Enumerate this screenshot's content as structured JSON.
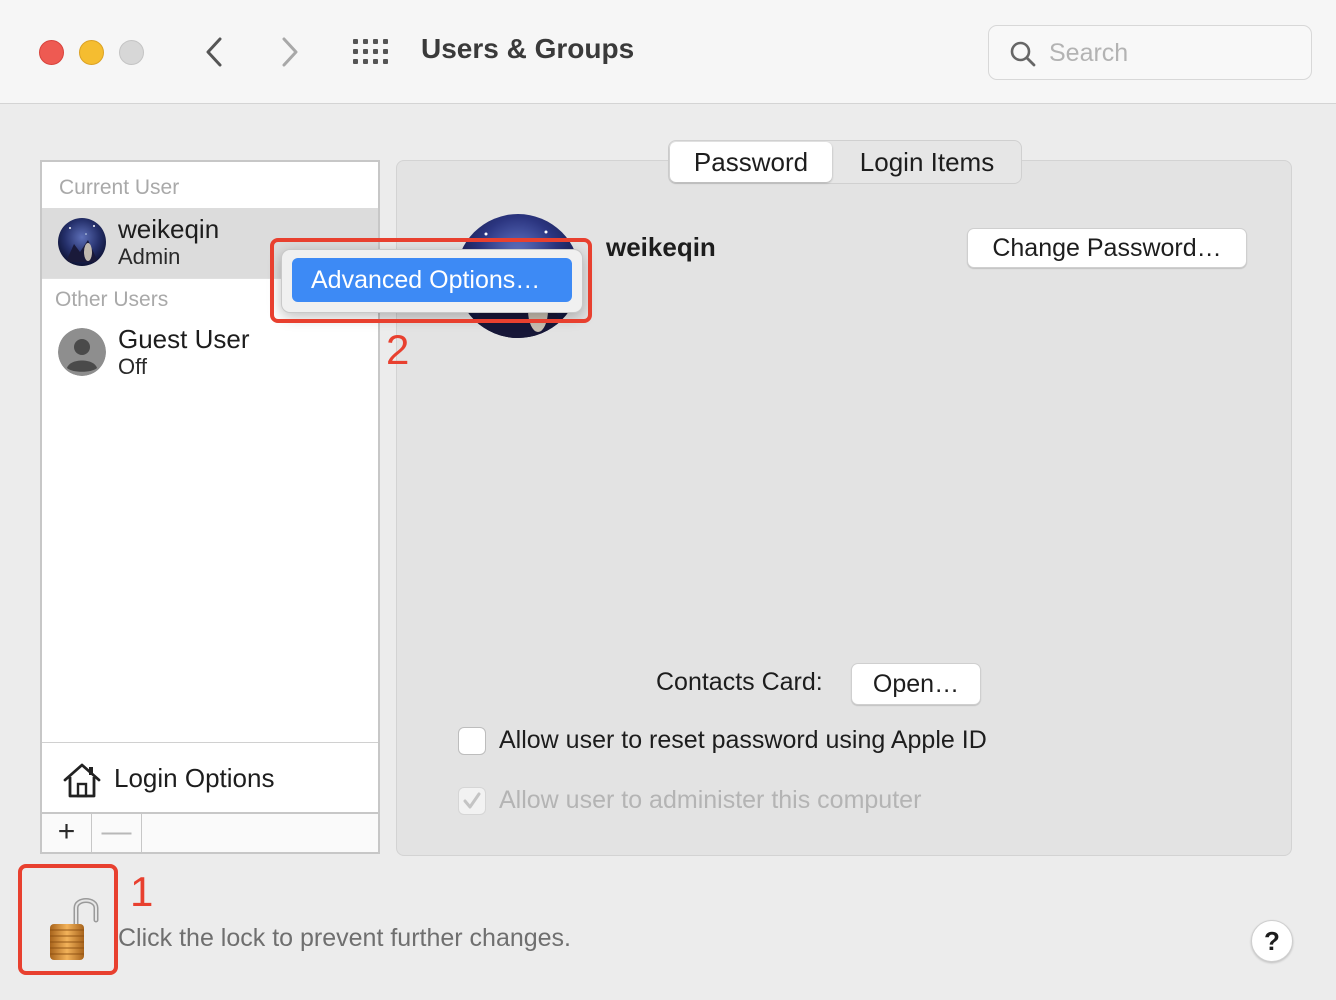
{
  "window": {
    "title": "Users & Groups",
    "search_placeholder": "Search"
  },
  "sidebar": {
    "current_user_header": "Current User",
    "other_users_header": "Other Users",
    "users": [
      {
        "name": "weikeqin",
        "role": "Admin",
        "selected": true
      },
      {
        "name": "Guest User",
        "role": "Off",
        "selected": false
      }
    ],
    "login_options_label": "Login Options",
    "add_label": "+",
    "remove_label": "—"
  },
  "tabs": [
    {
      "label": "Password",
      "selected": true
    },
    {
      "label": "Login Items",
      "selected": false
    }
  ],
  "profile": {
    "name": "weikeqin",
    "change_password_label": "Change Password…",
    "contacts_card_label": "Contacts Card:",
    "open_label": "Open…",
    "reset_password_checkbox": {
      "label": "Allow user to reset password using Apple ID",
      "checked": false
    },
    "administer_checkbox": {
      "label": "Allow user to administer this computer",
      "checked": true,
      "disabled": true
    }
  },
  "context_menu": {
    "item_label": "Advanced Options…"
  },
  "annotations": {
    "step_1": "1",
    "step_2": "2",
    "color": "#e8402f"
  },
  "footer": {
    "lock_text": "Click the lock to prevent further changes.",
    "help_label": "?"
  },
  "colors": {
    "accent": "#3d8af5",
    "close": "#ee5a52",
    "minimize": "#f5bd30",
    "zoom_disabled": "#d7d7d7"
  }
}
